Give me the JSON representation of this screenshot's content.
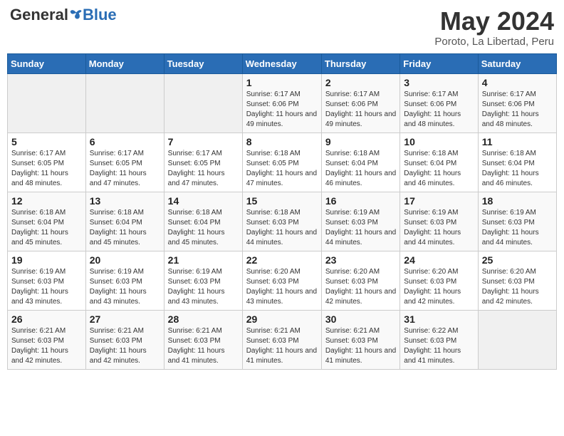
{
  "header": {
    "logo_general": "General",
    "logo_blue": "Blue",
    "month_title": "May 2024",
    "location": "Poroto, La Libertad, Peru"
  },
  "weekdays": [
    "Sunday",
    "Monday",
    "Tuesday",
    "Wednesday",
    "Thursday",
    "Friday",
    "Saturday"
  ],
  "weeks": [
    [
      {
        "day": "",
        "sunrise": "",
        "sunset": "",
        "daylight": ""
      },
      {
        "day": "",
        "sunrise": "",
        "sunset": "",
        "daylight": ""
      },
      {
        "day": "",
        "sunrise": "",
        "sunset": "",
        "daylight": ""
      },
      {
        "day": "1",
        "sunrise": "Sunrise: 6:17 AM",
        "sunset": "Sunset: 6:06 PM",
        "daylight": "Daylight: 11 hours and 49 minutes."
      },
      {
        "day": "2",
        "sunrise": "Sunrise: 6:17 AM",
        "sunset": "Sunset: 6:06 PM",
        "daylight": "Daylight: 11 hours and 49 minutes."
      },
      {
        "day": "3",
        "sunrise": "Sunrise: 6:17 AM",
        "sunset": "Sunset: 6:06 PM",
        "daylight": "Daylight: 11 hours and 48 minutes."
      },
      {
        "day": "4",
        "sunrise": "Sunrise: 6:17 AM",
        "sunset": "Sunset: 6:06 PM",
        "daylight": "Daylight: 11 hours and 48 minutes."
      }
    ],
    [
      {
        "day": "5",
        "sunrise": "Sunrise: 6:17 AM",
        "sunset": "Sunset: 6:05 PM",
        "daylight": "Daylight: 11 hours and 48 minutes."
      },
      {
        "day": "6",
        "sunrise": "Sunrise: 6:17 AM",
        "sunset": "Sunset: 6:05 PM",
        "daylight": "Daylight: 11 hours and 47 minutes."
      },
      {
        "day": "7",
        "sunrise": "Sunrise: 6:17 AM",
        "sunset": "Sunset: 6:05 PM",
        "daylight": "Daylight: 11 hours and 47 minutes."
      },
      {
        "day": "8",
        "sunrise": "Sunrise: 6:18 AM",
        "sunset": "Sunset: 6:05 PM",
        "daylight": "Daylight: 11 hours and 47 minutes."
      },
      {
        "day": "9",
        "sunrise": "Sunrise: 6:18 AM",
        "sunset": "Sunset: 6:04 PM",
        "daylight": "Daylight: 11 hours and 46 minutes."
      },
      {
        "day": "10",
        "sunrise": "Sunrise: 6:18 AM",
        "sunset": "Sunset: 6:04 PM",
        "daylight": "Daylight: 11 hours and 46 minutes."
      },
      {
        "day": "11",
        "sunrise": "Sunrise: 6:18 AM",
        "sunset": "Sunset: 6:04 PM",
        "daylight": "Daylight: 11 hours and 46 minutes."
      }
    ],
    [
      {
        "day": "12",
        "sunrise": "Sunrise: 6:18 AM",
        "sunset": "Sunset: 6:04 PM",
        "daylight": "Daylight: 11 hours and 45 minutes."
      },
      {
        "day": "13",
        "sunrise": "Sunrise: 6:18 AM",
        "sunset": "Sunset: 6:04 PM",
        "daylight": "Daylight: 11 hours and 45 minutes."
      },
      {
        "day": "14",
        "sunrise": "Sunrise: 6:18 AM",
        "sunset": "Sunset: 6:04 PM",
        "daylight": "Daylight: 11 hours and 45 minutes."
      },
      {
        "day": "15",
        "sunrise": "Sunrise: 6:18 AM",
        "sunset": "Sunset: 6:03 PM",
        "daylight": "Daylight: 11 hours and 44 minutes."
      },
      {
        "day": "16",
        "sunrise": "Sunrise: 6:19 AM",
        "sunset": "Sunset: 6:03 PM",
        "daylight": "Daylight: 11 hours and 44 minutes."
      },
      {
        "day": "17",
        "sunrise": "Sunrise: 6:19 AM",
        "sunset": "Sunset: 6:03 PM",
        "daylight": "Daylight: 11 hours and 44 minutes."
      },
      {
        "day": "18",
        "sunrise": "Sunrise: 6:19 AM",
        "sunset": "Sunset: 6:03 PM",
        "daylight": "Daylight: 11 hours and 44 minutes."
      }
    ],
    [
      {
        "day": "19",
        "sunrise": "Sunrise: 6:19 AM",
        "sunset": "Sunset: 6:03 PM",
        "daylight": "Daylight: 11 hours and 43 minutes."
      },
      {
        "day": "20",
        "sunrise": "Sunrise: 6:19 AM",
        "sunset": "Sunset: 6:03 PM",
        "daylight": "Daylight: 11 hours and 43 minutes."
      },
      {
        "day": "21",
        "sunrise": "Sunrise: 6:19 AM",
        "sunset": "Sunset: 6:03 PM",
        "daylight": "Daylight: 11 hours and 43 minutes."
      },
      {
        "day": "22",
        "sunrise": "Sunrise: 6:20 AM",
        "sunset": "Sunset: 6:03 PM",
        "daylight": "Daylight: 11 hours and 43 minutes."
      },
      {
        "day": "23",
        "sunrise": "Sunrise: 6:20 AM",
        "sunset": "Sunset: 6:03 PM",
        "daylight": "Daylight: 11 hours and 42 minutes."
      },
      {
        "day": "24",
        "sunrise": "Sunrise: 6:20 AM",
        "sunset": "Sunset: 6:03 PM",
        "daylight": "Daylight: 11 hours and 42 minutes."
      },
      {
        "day": "25",
        "sunrise": "Sunrise: 6:20 AM",
        "sunset": "Sunset: 6:03 PM",
        "daylight": "Daylight: 11 hours and 42 minutes."
      }
    ],
    [
      {
        "day": "26",
        "sunrise": "Sunrise: 6:21 AM",
        "sunset": "Sunset: 6:03 PM",
        "daylight": "Daylight: 11 hours and 42 minutes."
      },
      {
        "day": "27",
        "sunrise": "Sunrise: 6:21 AM",
        "sunset": "Sunset: 6:03 PM",
        "daylight": "Daylight: 11 hours and 42 minutes."
      },
      {
        "day": "28",
        "sunrise": "Sunrise: 6:21 AM",
        "sunset": "Sunset: 6:03 PM",
        "daylight": "Daylight: 11 hours and 41 minutes."
      },
      {
        "day": "29",
        "sunrise": "Sunrise: 6:21 AM",
        "sunset": "Sunset: 6:03 PM",
        "daylight": "Daylight: 11 hours and 41 minutes."
      },
      {
        "day": "30",
        "sunrise": "Sunrise: 6:21 AM",
        "sunset": "Sunset: 6:03 PM",
        "daylight": "Daylight: 11 hours and 41 minutes."
      },
      {
        "day": "31",
        "sunrise": "Sunrise: 6:22 AM",
        "sunset": "Sunset: 6:03 PM",
        "daylight": "Daylight: 11 hours and 41 minutes."
      },
      {
        "day": "",
        "sunrise": "",
        "sunset": "",
        "daylight": ""
      }
    ]
  ]
}
